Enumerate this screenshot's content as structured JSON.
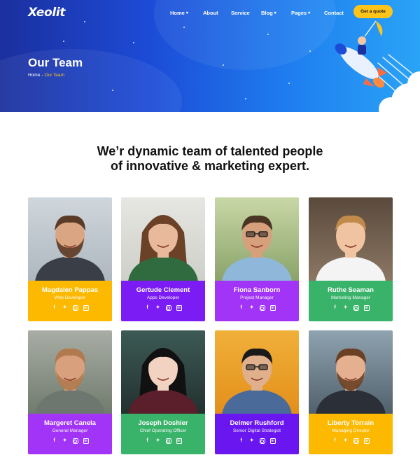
{
  "header": {
    "logo": "Xeolit",
    "nav": [
      {
        "label": "Home",
        "has_dropdown": true
      },
      {
        "label": "About",
        "has_dropdown": false
      },
      {
        "label": "Service",
        "has_dropdown": false
      },
      {
        "label": "Blog",
        "has_dropdown": true
      },
      {
        "label": "Pages",
        "has_dropdown": true
      },
      {
        "label": "Contact",
        "has_dropdown": false
      }
    ],
    "cta": "Get a quote"
  },
  "hero": {
    "title": "Our Team",
    "breadcrumb": {
      "home": "Home",
      "separator": "-",
      "current": "Our Team"
    }
  },
  "section": {
    "headline_line1": "We’r dynamic team of talented people",
    "headline_line2": "of innovative & marketing expert."
  },
  "social_icons": [
    "facebook-icon",
    "twitter-icon",
    "instagram-icon",
    "linkedin-icon"
  ],
  "team": [
    {
      "name": "Magdalen Pappas",
      "role": "Web Developer",
      "color": "#fcb900"
    },
    {
      "name": "Gertude Clement",
      "role": "Apps Developer",
      "color": "#7c1cf4"
    },
    {
      "name": "Fiona Sanborn",
      "role": "Project Manager",
      "color": "#a234f8"
    },
    {
      "name": "Ruthe Seaman",
      "role": "Marketing Manager",
      "color": "#3ab36a"
    },
    {
      "name": "Margeret Canela",
      "role": "General Manager",
      "color": "#a234f8"
    },
    {
      "name": "Joseph Doshier",
      "role": "Chief Operating Officer",
      "color": "#3ab36a"
    },
    {
      "name": "Delmer Rushford",
      "role": "Senior Digital Strategist",
      "color": "#6a16f0"
    },
    {
      "name": "Liberty Torrain",
      "role": "Managing Director",
      "color": "#fcb900"
    }
  ],
  "colors": {
    "accent_yellow": "#ffc41a",
    "hero_start": "#1b2f9e",
    "hero_end": "#2aa4f6"
  }
}
